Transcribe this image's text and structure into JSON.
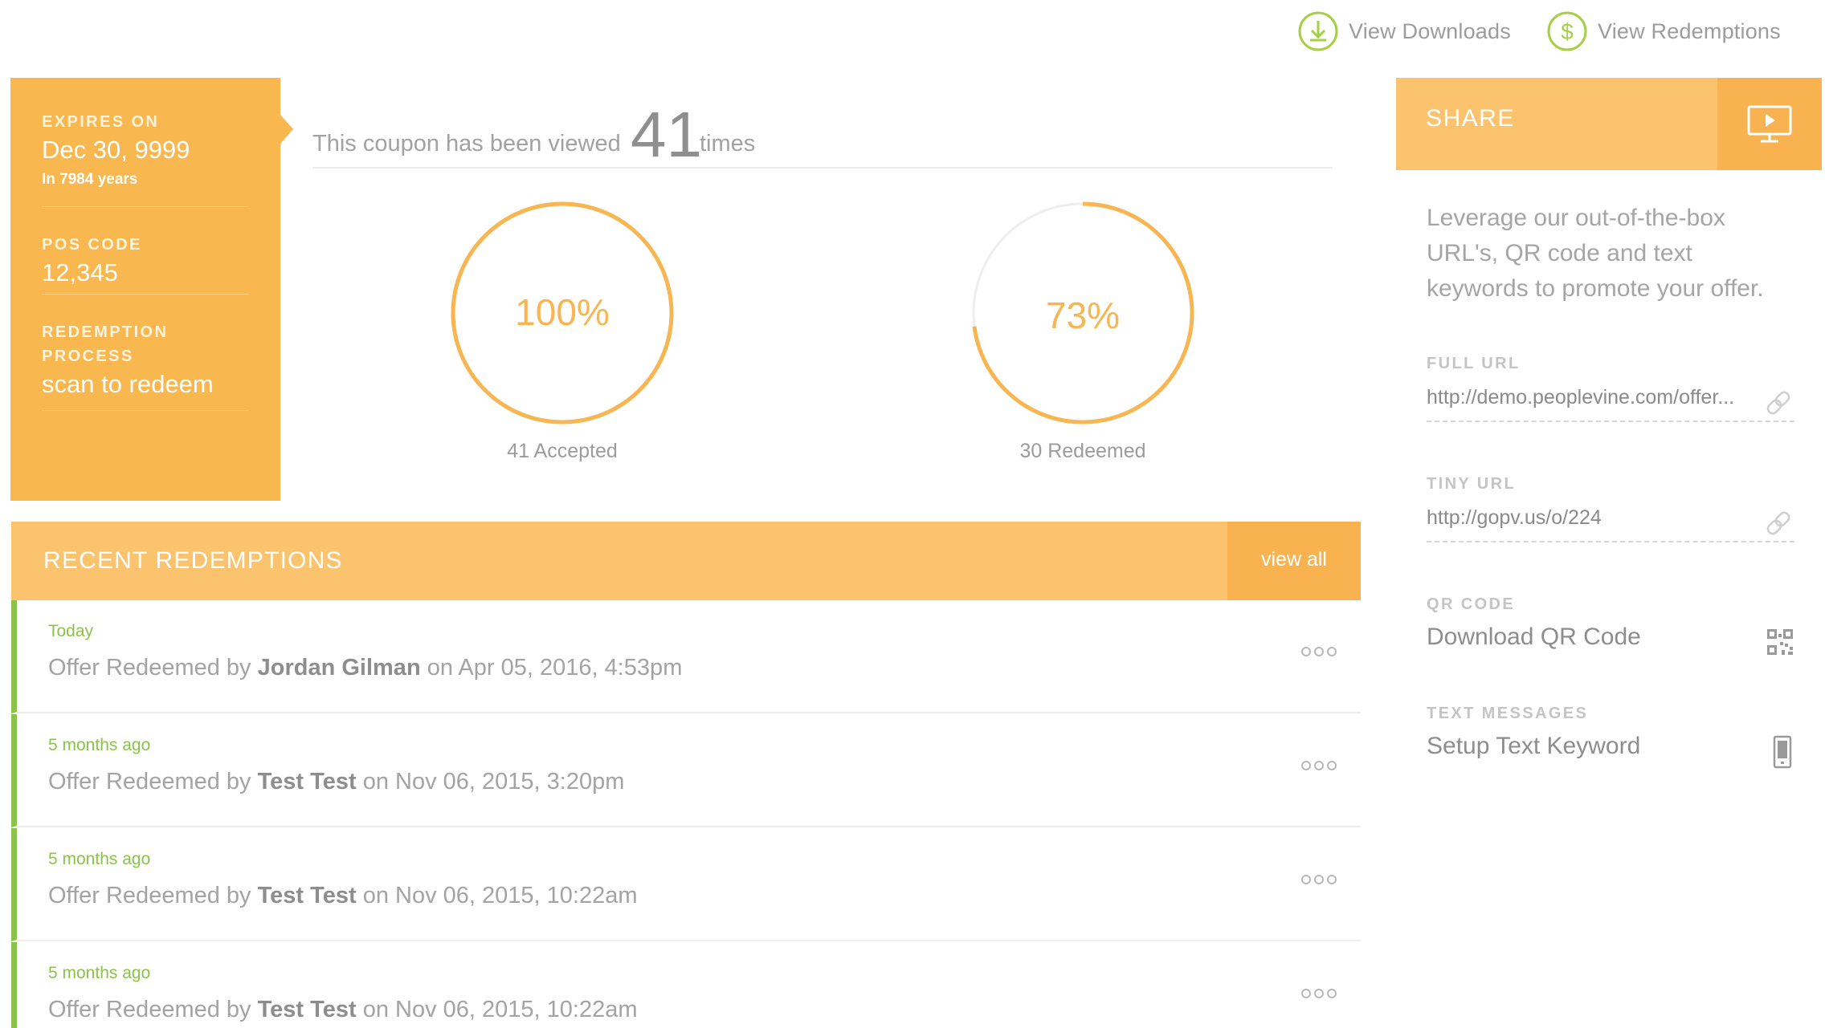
{
  "top_links": {
    "downloads_label": "View Downloads",
    "redemptions_label": "View Redemptions"
  },
  "info": {
    "expires_label": "EXPIRES ON",
    "expires_value": "Dec 30, 9999",
    "expires_sub": "In 7984 years",
    "pos_label": "POS CODE",
    "pos_value": "12,345",
    "process_label": "REDEMPTION PROCESS",
    "process_value": "scan to redeem"
  },
  "views": {
    "prefix": "This coupon has been viewed",
    "count": "41",
    "suffix": "times"
  },
  "gauges": [
    {
      "percent_label": "100%",
      "fraction": 1.0,
      "caption": "41 Accepted"
    },
    {
      "percent_label": "73%",
      "fraction": 0.73,
      "caption": "30 Redeemed"
    }
  ],
  "recent": {
    "title": "RECENT REDEMPTIONS",
    "view_all": "view all",
    "rows": [
      {
        "when": "Today",
        "prefix": "Offer Redeemed by",
        "name": "Jordan Gilman",
        "suffix": "on Apr 05, 2016, 4:53pm"
      },
      {
        "when": "5 months ago",
        "prefix": "Offer Redeemed by",
        "name": "Test Test",
        "suffix": "on Nov 06, 2015, 3:20pm"
      },
      {
        "when": "5 months ago",
        "prefix": "Offer Redeemed by",
        "name": "Test Test",
        "suffix": "on Nov 06, 2015, 10:22am"
      },
      {
        "when": "5 months ago",
        "prefix": "Offer Redeemed by",
        "name": "Test Test",
        "suffix": "on Nov 06, 2015, 10:22am"
      }
    ]
  },
  "share": {
    "title": "SHARE",
    "description": "Leverage our out-of-the-box URL's, QR code and text keywords to promote your offer.",
    "full_url_label": "FULL URL",
    "full_url_value": "http://demo.peoplevine.com/offer...",
    "tiny_url_label": "TINY URL",
    "tiny_url_value": "http://gopv.us/o/224",
    "qr_label": "QR CODE",
    "qr_value": "Download QR Code",
    "text_label": "TEXT MESSAGES",
    "text_value": "Setup Text Keyword"
  },
  "colors": {
    "accent_orange": "#f9b74f",
    "accent_light_orange": "#fcc36e",
    "success_green": "#8bc34a",
    "text_gray": "#9a9a9a"
  }
}
